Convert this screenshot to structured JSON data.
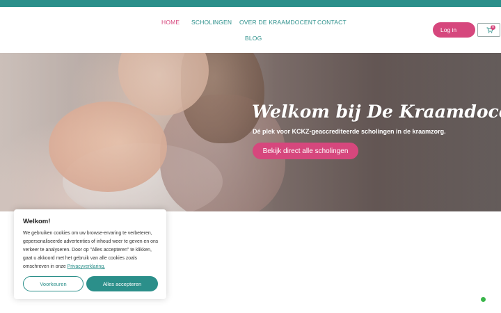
{
  "colors": {
    "teal": "#2b8f8a",
    "pink": "#d6477d",
    "white": "#ffffff"
  },
  "nav": {
    "items": [
      {
        "label": "HOME",
        "active": true
      },
      {
        "label": "SCHOLINGEN",
        "active": false
      },
      {
        "label": "OVER DE KRAAMDOCENT",
        "active": false
      },
      {
        "label": "CONTACT",
        "active": false
      },
      {
        "label": "BLOG",
        "active": false
      }
    ]
  },
  "header": {
    "login_label": "Log in",
    "cart_icon": "cart-icon",
    "cart_count": "0"
  },
  "hero": {
    "title": "Welkom bij De Kraamdocent",
    "subtitle": "Dé plek voor KCKZ-geaccrediteerde scholingen in de kraamzorg.",
    "cta_label": "Bekijk direct alle scholingen"
  },
  "cookie": {
    "title": "Welkom!",
    "body": "We gebruiken cookies om uw browse-ervaring te verbeteren, gepersonaliseerde advertenties of inhoud weer te geven en ons verkeer te analyseren. Door op \"Alles accepteren\" te klikken, gaat u akkoord met het gebruik van alle cookies zoals omschreven in onze",
    "link_label": "Privacyverklaring.",
    "preferences_label": "Voorkeuren",
    "accept_label": "Alles accepteren"
  }
}
